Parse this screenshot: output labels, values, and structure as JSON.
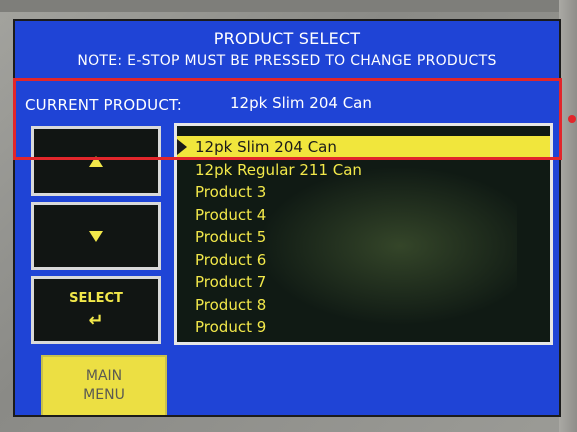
{
  "screen": {
    "title": "PRODUCT SELECT",
    "note": "NOTE:  E-STOP MUST BE PRESSED TO CHANGE PRODUCTS",
    "current_label": "CURRENT PRODUCT:",
    "current_value": "12pk Slim 204 Can"
  },
  "buttons": {
    "up_icon": "up-triangle-icon",
    "down_icon": "down-triangle-icon",
    "select_label": "SELECT",
    "select_icon": "enter-arrow-icon",
    "main_menu_line1": "MAIN",
    "main_menu_line2": "MENU"
  },
  "products": [
    "12pk Slim 204 Can",
    "12pk Regular 211 Can",
    "Product 3",
    "Product 4",
    "Product 5",
    "Product 6",
    "Product 7",
    "Product 8",
    "Product 9"
  ],
  "selected_index": 0,
  "colors": {
    "screen_bg": "#1f44d6",
    "highlight": "#f1e63c",
    "list_text": "#f2e84a",
    "annotation": "#e2262b"
  }
}
